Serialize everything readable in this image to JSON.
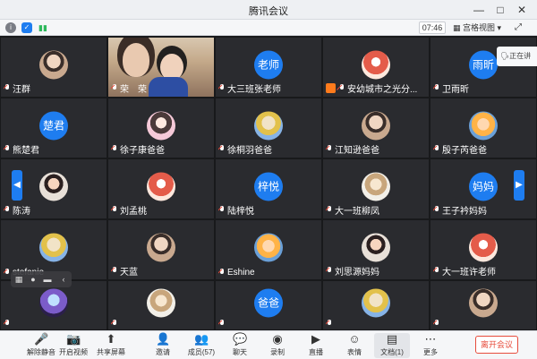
{
  "window": {
    "title": "腾讯会议",
    "min_icon": "minimize-icon",
    "max_icon": "maximize-icon",
    "close_icon": "close-icon"
  },
  "toolbar": {
    "time": "07:46",
    "view_label": "宫格视图",
    "info_icon": "info-icon",
    "shield_icon": "shield-icon",
    "signal_icon": "signal-icon",
    "fullscreen_icon": "fullscreen-icon"
  },
  "speaking_text": "正在讲",
  "tiles": [
    {
      "name": "汪群",
      "avatar_type": "photo"
    },
    {
      "name": "荣 荣",
      "avatar_type": "video"
    },
    {
      "name": "大三班张老师",
      "avatar_type": "text",
      "avatar_text": "老师"
    },
    {
      "name": "安幼城市之光分...",
      "avatar_type": "photo",
      "host": true
    },
    {
      "name": "卫雨昕",
      "avatar_type": "text",
      "avatar_text": "雨昕"
    },
    {
      "name": "熊楚君",
      "avatar_type": "text",
      "avatar_text": "楚君"
    },
    {
      "name": "徐子康爸爸",
      "avatar_type": "photo"
    },
    {
      "name": "徐桐羽爸爸",
      "avatar_type": "photo"
    },
    {
      "name": "江知逊爸爸",
      "avatar_type": "photo"
    },
    {
      "name": "殷子芮爸爸",
      "avatar_type": "photo"
    },
    {
      "name": "陈涛",
      "avatar_type": "photo"
    },
    {
      "name": "刘孟桃",
      "avatar_type": "photo"
    },
    {
      "name": "陆梓悦",
      "avatar_type": "text",
      "avatar_text": "梓悦"
    },
    {
      "name": "大一班柳凤",
      "avatar_type": "photo"
    },
    {
      "name": "王子衿妈妈",
      "avatar_type": "text",
      "avatar_text": "妈妈"
    },
    {
      "name": "stefanie",
      "avatar_type": "photo"
    },
    {
      "name": "天蓝",
      "avatar_type": "photo"
    },
    {
      "name": "Eshine",
      "avatar_type": "photo"
    },
    {
      "name": "刘思源妈妈",
      "avatar_type": "photo"
    },
    {
      "name": "大一班许老师",
      "avatar_type": "photo"
    },
    {
      "name": "",
      "avatar_type": "photo"
    },
    {
      "name": "",
      "avatar_type": "photo"
    },
    {
      "name": "",
      "avatar_type": "text",
      "avatar_text": "爸爸"
    },
    {
      "name": "",
      "avatar_type": "photo"
    },
    {
      "name": "",
      "avatar_type": "photo"
    }
  ],
  "bottom": {
    "tools": [
      {
        "label": "解除静音",
        "icon": "mic-muted-icon"
      },
      {
        "label": "开启视频",
        "icon": "camera-off-icon"
      },
      {
        "label": "共享屏幕",
        "icon": "share-screen-icon"
      },
      {
        "label": "邀请",
        "icon": "invite-icon"
      },
      {
        "label": "成员(57)",
        "icon": "members-icon"
      },
      {
        "label": "聊天",
        "icon": "chat-icon"
      },
      {
        "label": "录制",
        "icon": "record-icon"
      },
      {
        "label": "直播",
        "icon": "live-icon"
      },
      {
        "label": "表情",
        "icon": "emoji-icon"
      },
      {
        "label": "文档(1)",
        "icon": "document-icon"
      },
      {
        "label": "更多",
        "icon": "more-icon"
      }
    ],
    "leave_label": "离开会议"
  }
}
